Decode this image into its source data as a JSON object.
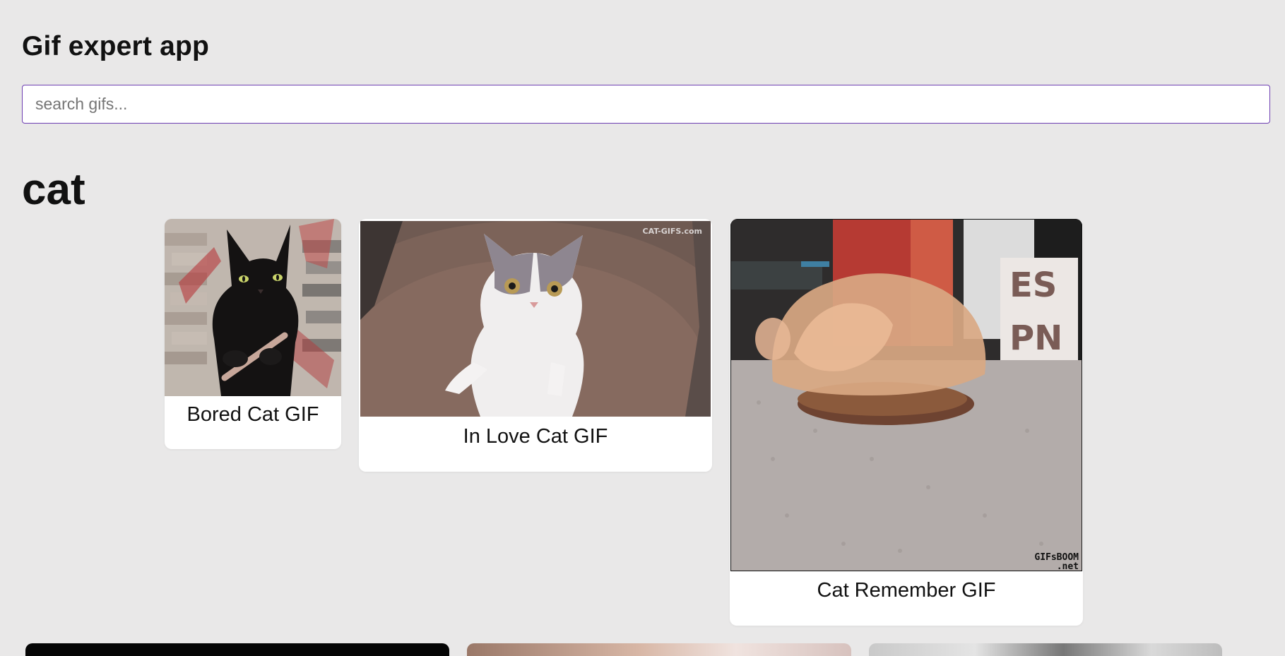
{
  "app": {
    "title": "Gif expert app"
  },
  "search": {
    "placeholder": "search gifs...",
    "value": ""
  },
  "categories": [
    {
      "title": "cat",
      "gifs": [
        {
          "title": "Bored Cat GIF"
        },
        {
          "title": "In Love Cat GIF",
          "watermark": "CAT-GIFS.com"
        },
        {
          "title": "Cat Remember GIF",
          "watermark_line1": "GIFsBOOM",
          "watermark_line2": ".net",
          "box_text_1": "ES",
          "box_text_2": "PN"
        }
      ]
    }
  ],
  "colors": {
    "background": "#e9e8e8",
    "card": "#ffffff",
    "search_border": "#6e3fb2"
  }
}
